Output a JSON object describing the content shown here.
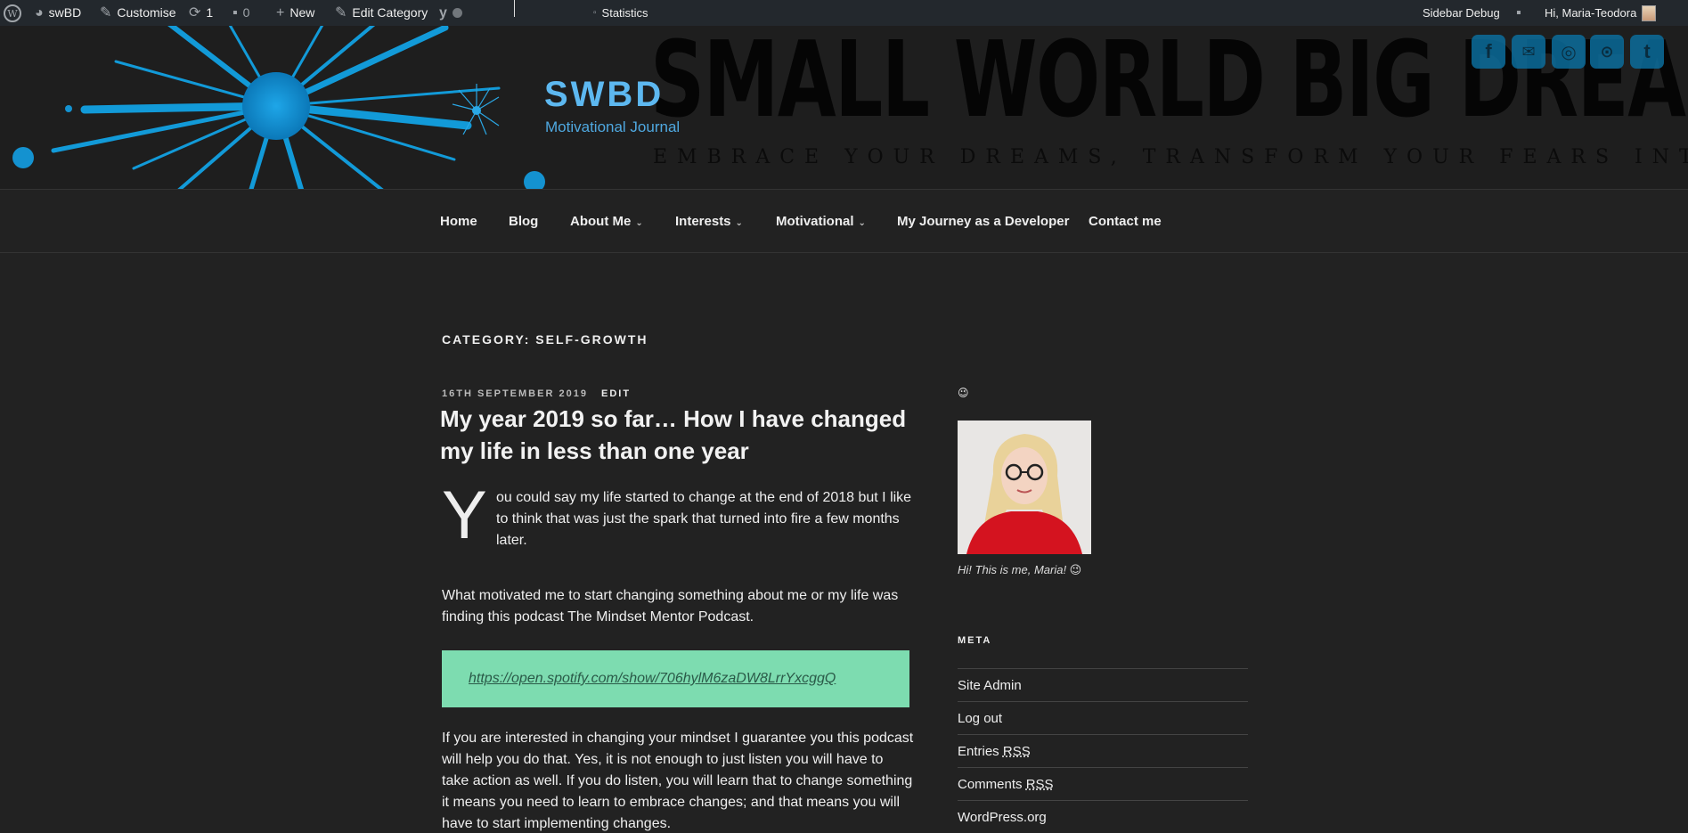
{
  "admin_bar": {
    "site_name": "swBD",
    "customise": "Customise",
    "updates_count": "1",
    "comments_count": "0",
    "new": "New",
    "edit_category": "Edit Category",
    "statistics_alt": "Statistics",
    "sidebar_debug": "Sidebar Debug",
    "greeting": "Hi, Maria-Teodora"
  },
  "header": {
    "banner_title": "SMALL WORLD BIG DREAMS",
    "banner_tagline": "EMBRACE YOUR DREAMS, TRANSFORM YOUR FEARS INTO PASSION",
    "site_title": "SWBD",
    "site_description": "Motivational Journal",
    "social_icons": [
      "facebook-icon",
      "email-icon",
      "instagram-icon",
      "rss-icon",
      "twitter-icon"
    ]
  },
  "nav": {
    "items": [
      {
        "label": "Home"
      },
      {
        "label": "Blog"
      },
      {
        "label": "About Me"
      },
      {
        "label": "Interests"
      },
      {
        "label": "Motivational"
      },
      {
        "label": "My Journey as a Developer"
      },
      {
        "label": "Contact me"
      }
    ]
  },
  "main": {
    "category_title": "CATEGORY: SELF-GROWTH",
    "post": {
      "date": "16TH SEPTEMBER 2019",
      "edit": "EDIT",
      "title": "My year 2019 so far… How I have changed my life in less than one year",
      "dropcap": "Y",
      "para1": "ou could say my life started to change at the end of 2018 but I like to think that was just the spark that turned into fire a few months later.",
      "para2": "What motivated me to start changing something about me or my life was finding this podcast The Mindset Mentor Podcast.",
      "link": "https://open.spotify.com/show/706hylM6zaDW8LrrYxcggQ",
      "para3": "If you are interested in changing your mindset I guarantee you this podcast will help you do that. Yes, it is not enough to just listen you will have to take action as well. If you do listen, you will learn that to change something it means you need to learn to embrace changes; and that means you will have to start implementing changes."
    }
  },
  "sidebar": {
    "wink": "😉",
    "caption": "Hi! This is me, Maria! 😉",
    "meta_title": "META",
    "meta_items": {
      "site_admin": "Site Admin",
      "log_out": "Log out",
      "entries": "Entries",
      "comments": "Comments",
      "rss": "RSS",
      "wordpress": "WordPress.org"
    }
  },
  "colors": {
    "accent_blue": "#5db8f0",
    "link_box": "#7ddcb0",
    "background": "#222222"
  }
}
